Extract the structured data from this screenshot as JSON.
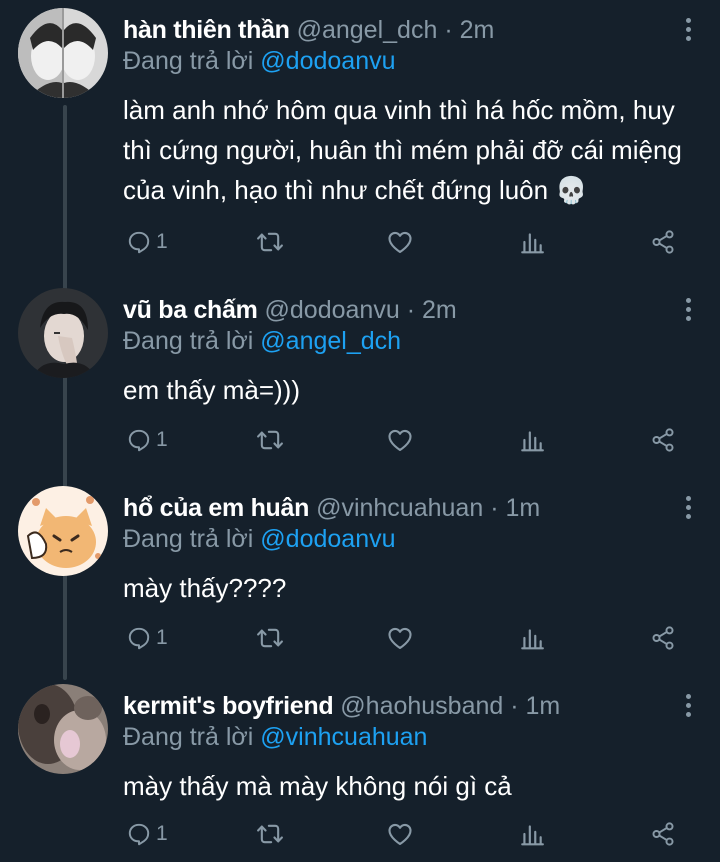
{
  "tweets": [
    {
      "name": "hàn thiên thần",
      "handle": "@angel_dch",
      "time": "· 2m",
      "reply_prefix": "Đang trả lời",
      "reply_to": "@dodoanvu",
      "text": "làm anh nhớ hôm qua vinh thì há hốc mồm, huy thì cứng người, huân thì mém phải đỡ cái miệng của vinh, hạo thì như chết đứng luôn 💀",
      "reply_count": "1",
      "avatar": "avatar-mirror-portrait"
    },
    {
      "name": "vũ ba chấm",
      "handle": "@dodoanvu",
      "time": "· 2m",
      "reply_prefix": "Đang trả lời",
      "reply_to": "@angel_dch",
      "text": "em thấy mà=)))",
      "reply_count": "1",
      "avatar": "avatar-man-hand-on-face"
    },
    {
      "name": "hổ của em huân",
      "handle": "@vinhcuahuan",
      "time": "· 1m",
      "reply_prefix": "Đang trả lời",
      "reply_to": "@dodoanvu",
      "text": "mày thấy????",
      "reply_count": "1",
      "avatar": "avatar-cartoon-cat"
    },
    {
      "name": "kermit's boyfriend",
      "handle": "@haohusband",
      "time": "· 1m",
      "reply_prefix": "Đang trả lời",
      "reply_to": "@vinhcuahuan",
      "text": "mày thấy mà mày không nói gì cả",
      "reply_count": "1",
      "avatar": "avatar-blurry-cat"
    }
  ],
  "colors": {
    "background": "#15202b",
    "secondary_text": "#8899a6",
    "mention": "#1da1f2",
    "thread_line": "#38444d"
  },
  "icons": [
    "reply-icon",
    "retweet-icon",
    "like-icon",
    "analytics-icon",
    "share-icon",
    "more-options-icon",
    "skull-emoji"
  ]
}
